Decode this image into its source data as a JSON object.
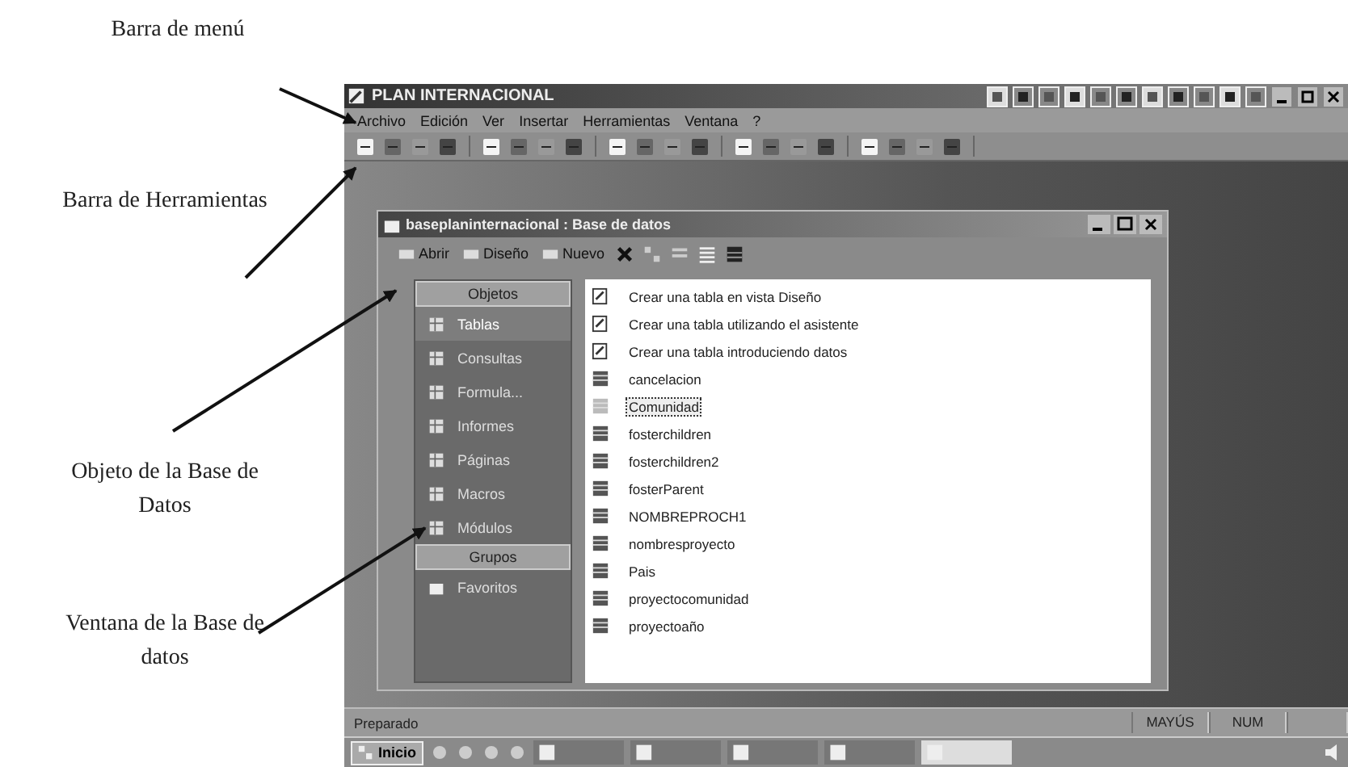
{
  "annotations": [
    {
      "text": "Barra de menú"
    },
    {
      "text": "Barra de Herramientas"
    },
    {
      "text": "Objeto de la Base de Datos"
    },
    {
      "text": "Ventana de la Base de datos"
    }
  ],
  "app": {
    "title": "PLAN INTERNACIONAL",
    "menu": [
      "Archivo",
      "Edición",
      "Ver",
      "Insertar",
      "Herramientas",
      "Ventana",
      "?"
    ],
    "status_bar": {
      "text": "Preparado",
      "indicators": [
        "MAYÚS",
        "NUM"
      ]
    },
    "taskbar": {
      "start": "Inicio"
    }
  },
  "db_window": {
    "title": "baseplaninternacional : Base de datos",
    "toolbar": [
      "Abrir",
      "Diseño",
      "Nuevo"
    ],
    "objects_header": "Objetos",
    "objects": [
      {
        "label": "Tablas",
        "selected": true
      },
      {
        "label": "Consultas",
        "selected": false
      },
      {
        "label": "Formula...",
        "selected": false
      },
      {
        "label": "Informes",
        "selected": false
      },
      {
        "label": "Páginas",
        "selected": false
      },
      {
        "label": "Macros",
        "selected": false
      },
      {
        "label": "Módulos",
        "selected": false
      }
    ],
    "groups_header": "Grupos",
    "groups": [
      {
        "label": "Favoritos"
      }
    ],
    "items": [
      {
        "label": "Crear una tabla en vista Diseño",
        "kind": "wizard",
        "selected": false
      },
      {
        "label": "Crear una tabla utilizando el asistente",
        "kind": "wizard",
        "selected": false
      },
      {
        "label": "Crear una tabla introduciendo datos",
        "kind": "wizard",
        "selected": false
      },
      {
        "label": "cancelacion",
        "kind": "table",
        "selected": false
      },
      {
        "label": "Comunidad",
        "kind": "table",
        "selected": true
      },
      {
        "label": "fosterchildren",
        "kind": "table",
        "selected": false
      },
      {
        "label": "fosterchildren2",
        "kind": "table",
        "selected": false
      },
      {
        "label": "fosterParent",
        "kind": "table",
        "selected": false
      },
      {
        "label": "NOMBREPROCH1",
        "kind": "table",
        "selected": false
      },
      {
        "label": "nombresproyecto",
        "kind": "table",
        "selected": false
      },
      {
        "label": "Pais",
        "kind": "table",
        "selected": false
      },
      {
        "label": "proyectocomunidad",
        "kind": "table",
        "selected": false
      },
      {
        "label": "proyectoaño",
        "kind": "table",
        "selected": false
      }
    ]
  }
}
